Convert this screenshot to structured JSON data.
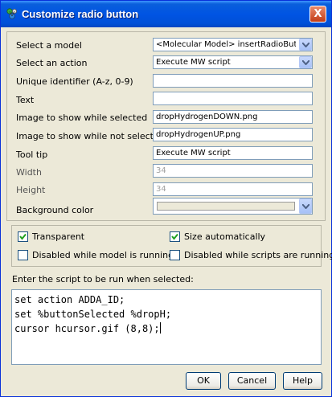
{
  "window": {
    "title": "Customize radio button",
    "close_label": "X"
  },
  "form": {
    "model": {
      "label": "Select a model",
      "value": "<Molecular Model> insertRadioButto..."
    },
    "action": {
      "label": "Select an action",
      "value": "Execute MW script"
    },
    "uid": {
      "label": "Unique identifier (A-z, 0-9)",
      "value": ""
    },
    "text": {
      "label": "Text",
      "value": ""
    },
    "img_selected": {
      "label": "Image to show while selected",
      "value": "dropHydrogenDOWN.png"
    },
    "img_unselected": {
      "label": "Image to show while not selected",
      "value": "dropHydrogenUP.png"
    },
    "tooltip": {
      "label": "Tool tip",
      "value": "Execute MW script"
    },
    "width": {
      "label": "Width",
      "value": "34"
    },
    "height": {
      "label": "Height",
      "value": "34"
    },
    "bgcolor": {
      "label": "Background color",
      "value": "#ece9d8"
    }
  },
  "options": {
    "transparent": {
      "label": "Transparent",
      "checked": true
    },
    "size_auto": {
      "label": "Size automatically",
      "checked": true
    },
    "disabled_model": {
      "label": "Disabled while model is running",
      "checked": false
    },
    "disabled_scripts": {
      "label": "Disabled while scripts are running",
      "checked": false
    }
  },
  "script": {
    "label": "Enter the script to be run when selected:",
    "lines": [
      "set action ADDA_ID;",
      "set %buttonSelected %dropH;",
      "cursor hcursor.gif (8,8);"
    ]
  },
  "buttons": {
    "ok": "OK",
    "cancel": "Cancel",
    "help": "Help"
  },
  "colors": {
    "titlebar": "#0054e3",
    "dialog_bg": "#ece9d8",
    "field_border": "#7f9db9",
    "check_green": "#21a121"
  }
}
